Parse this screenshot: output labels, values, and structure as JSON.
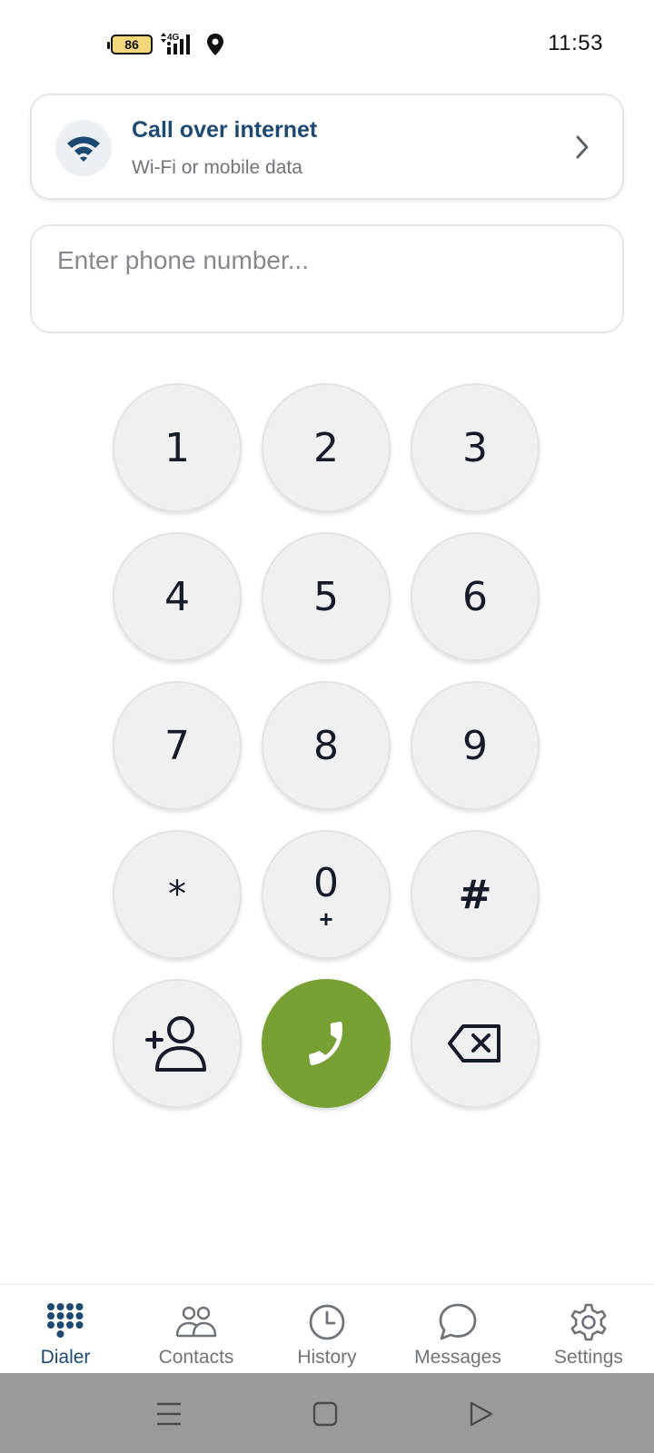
{
  "status_bar": {
    "battery_level": "86",
    "network": "4G",
    "time": "11:53"
  },
  "internet_card": {
    "title": "Call over internet",
    "subtitle": "Wi-Fi or mobile data",
    "icon": "wifi-icon"
  },
  "dial_input": {
    "placeholder": "Enter phone number...",
    "value": ""
  },
  "keypad": {
    "keys": [
      {
        "label": "1"
      },
      {
        "label": "2"
      },
      {
        "label": "3"
      },
      {
        "label": "4"
      },
      {
        "label": "5"
      },
      {
        "label": "6"
      },
      {
        "label": "7"
      },
      {
        "label": "8"
      },
      {
        "label": "9"
      },
      {
        "label": "*"
      },
      {
        "label": "0",
        "sub": "+"
      },
      {
        "label": "#"
      }
    ],
    "actions": {
      "add_contact_icon": "add-contact-icon",
      "call_icon": "phone-icon",
      "backspace_icon": "backspace-icon"
    }
  },
  "colors": {
    "accent": "#1d4a73",
    "call_button": "#76a132",
    "key_background": "#f0f0f0"
  },
  "bottom_nav": {
    "items": [
      {
        "label": "Dialer",
        "icon": "dialpad-icon",
        "active": true
      },
      {
        "label": "Contacts",
        "icon": "contacts-icon",
        "active": false
      },
      {
        "label": "History",
        "icon": "clock-icon",
        "active": false
      },
      {
        "label": "Messages",
        "icon": "chat-bubble-icon",
        "active": false
      },
      {
        "label": "Settings",
        "icon": "gear-icon",
        "active": false
      }
    ]
  },
  "system_nav": {
    "buttons": [
      "menu-icon",
      "home-icon",
      "back-icon"
    ]
  }
}
